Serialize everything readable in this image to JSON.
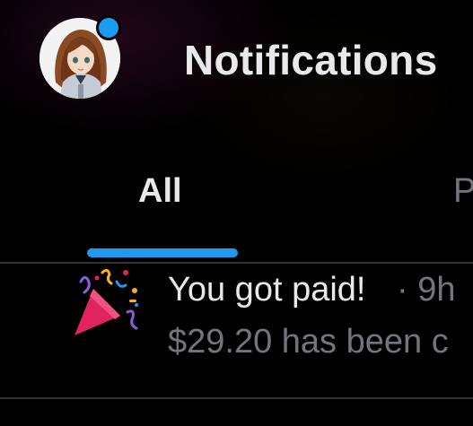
{
  "header": {
    "title": "Notifications"
  },
  "tabs": [
    {
      "label": "All",
      "selected": true
    },
    {
      "label": "P",
      "selected": false
    }
  ],
  "notifications": [
    {
      "icon": "party-popper-icon",
      "title": "You got paid!",
      "meta": "· 9h",
      "body": "$29.20 has been c"
    }
  ],
  "colors": {
    "accent": "#1d9bf0",
    "background": "#000000",
    "text_primary": "#e7e9ea",
    "text_secondary": "#71767b"
  }
}
